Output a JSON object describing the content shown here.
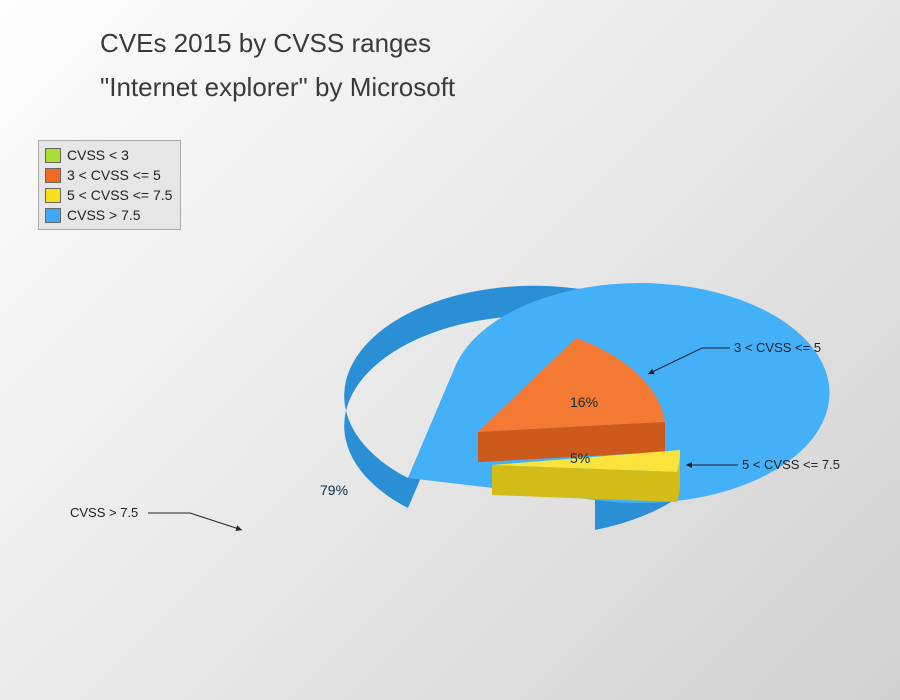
{
  "title": "CVEs 2015 by CVSS ranges",
  "subtitle": "\"Internet explorer\" by Microsoft",
  "legend": {
    "items": [
      {
        "label": "CVSS < 3",
        "color": "#aadc32"
      },
      {
        "label": "3 < CVSS <= 5",
        "color": "#f06a22"
      },
      {
        "label": "5 < CVSS <= 7.5",
        "color": "#f7de1c"
      },
      {
        "label": "CVSS > 7.5",
        "color": "#3fa9f5"
      }
    ]
  },
  "labels": {
    "pct_big": "79%",
    "pct_mid": "16%",
    "pct_small": "5%",
    "call_big": "CVSS > 7.5",
    "call_mid": "3 < CVSS <= 5",
    "call_small": "5 < CVSS <= 7.5"
  },
  "colors": {
    "blue_top": "#44b0f8",
    "blue_side": "#2a8fd5",
    "orange_top": "#f47a33",
    "orange_side": "#cc5a1a",
    "yellow_top": "#fae33a",
    "yellow_side": "#d4bc18"
  },
  "chart_data": {
    "type": "pie",
    "title": "CVEs 2015 by CVSS ranges",
    "subtitle": "\"Internet explorer\" by Microsoft",
    "series": [
      {
        "name": "CVSS < 3",
        "value": 0,
        "color": "#aadc32"
      },
      {
        "name": "3 < CVSS <= 5",
        "value": 16,
        "color": "#f06a22"
      },
      {
        "name": "5 < CVSS <= 7.5",
        "value": 5,
        "color": "#f7de1c"
      },
      {
        "name": "CVSS > 7.5",
        "value": 79,
        "color": "#3fa9f5"
      }
    ],
    "unit": "percent",
    "exploded": true,
    "three_d": true
  }
}
